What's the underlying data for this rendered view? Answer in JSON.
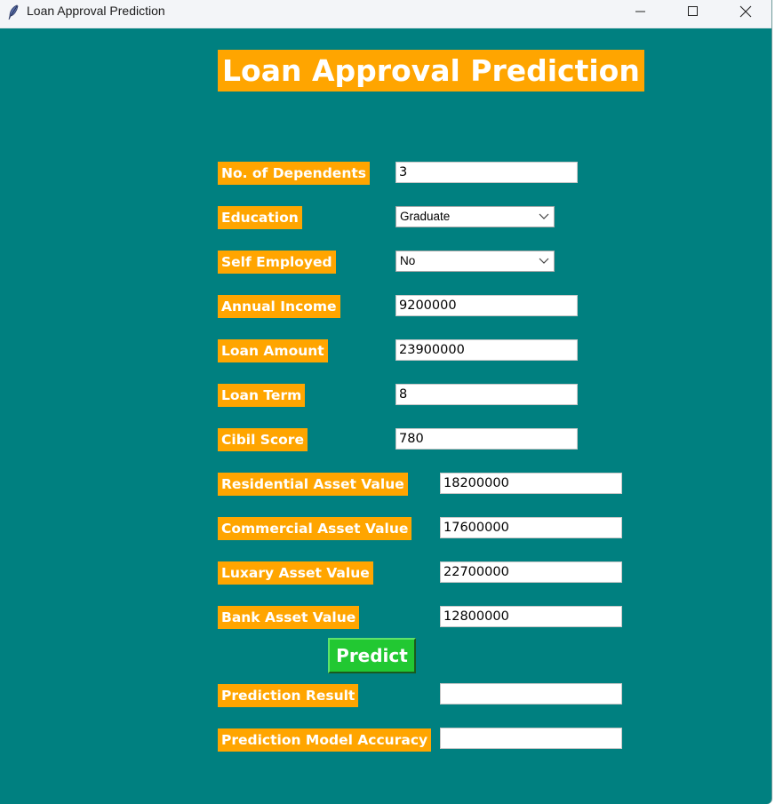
{
  "window": {
    "title": "Loan Approval Prediction"
  },
  "app": {
    "heading": "Loan Approval Prediction",
    "colors": {
      "background": "#008080",
      "label_bg": "#ffa500",
      "button_bg": "#22c832",
      "text": "#ffffff"
    }
  },
  "form": {
    "dependents": {
      "label": "No. of Dependents",
      "value": "3"
    },
    "education": {
      "label": "Education",
      "value": "Graduate"
    },
    "self_employed": {
      "label": "Self Employed",
      "value": "No"
    },
    "annual_income": {
      "label": "Annual Income",
      "value": "9200000"
    },
    "loan_amount": {
      "label": "Loan Amount",
      "value": "23900000"
    },
    "loan_term": {
      "label": "Loan Term",
      "value": "8"
    },
    "cibil_score": {
      "label": "Cibil Score",
      "value": "780"
    },
    "residential_asset": {
      "label": "Residential Asset Value",
      "value": "18200000"
    },
    "commercial_asset": {
      "label": "Commercial Asset Value",
      "value": "17600000"
    },
    "luxury_asset": {
      "label": "Luxary Asset Value",
      "value": "22700000"
    },
    "bank_asset": {
      "label": "Bank Asset Value",
      "value": "12800000"
    }
  },
  "predict_button": {
    "label": "Predict"
  },
  "results": {
    "prediction": {
      "label": "Prediction Result",
      "value": ""
    },
    "accuracy": {
      "label": "Prediction Model Accuracy",
      "value": ""
    }
  },
  "icons": {
    "app_icon": "feather-icon",
    "minimize": "minimize-icon",
    "maximize": "maximize-icon",
    "close": "close-icon",
    "dropdown": "chevron-down-icon"
  }
}
